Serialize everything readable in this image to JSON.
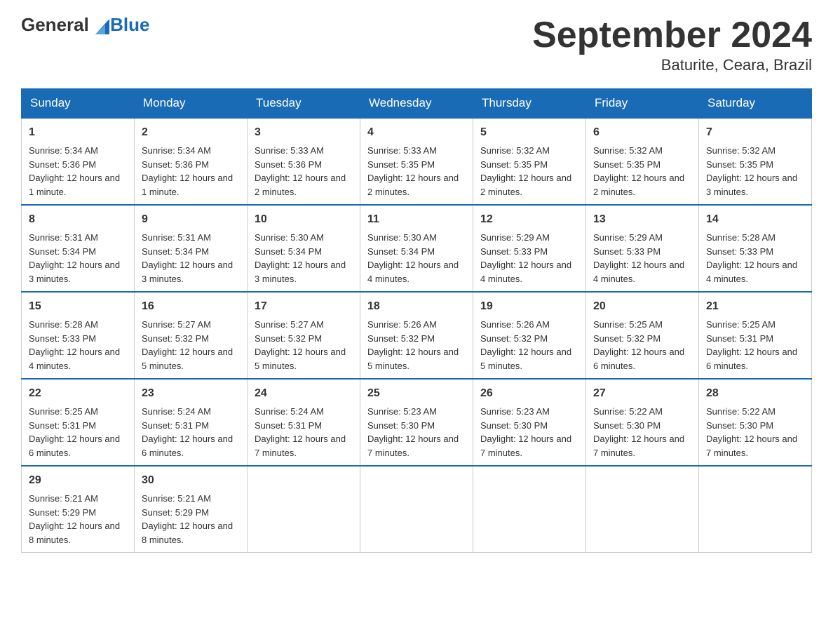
{
  "header": {
    "logo": {
      "general": "General",
      "blue": "Blue"
    },
    "title": "September 2024",
    "subtitle": "Baturite, Ceara, Brazil"
  },
  "weekdays": [
    "Sunday",
    "Monday",
    "Tuesday",
    "Wednesday",
    "Thursday",
    "Friday",
    "Saturday"
  ],
  "weeks": [
    [
      {
        "day": "1",
        "sunrise": "5:34 AM",
        "sunset": "5:36 PM",
        "daylight": "12 hours and 1 minute."
      },
      {
        "day": "2",
        "sunrise": "5:34 AM",
        "sunset": "5:36 PM",
        "daylight": "12 hours and 1 minute."
      },
      {
        "day": "3",
        "sunrise": "5:33 AM",
        "sunset": "5:36 PM",
        "daylight": "12 hours and 2 minutes."
      },
      {
        "day": "4",
        "sunrise": "5:33 AM",
        "sunset": "5:35 PM",
        "daylight": "12 hours and 2 minutes."
      },
      {
        "day": "5",
        "sunrise": "5:32 AM",
        "sunset": "5:35 PM",
        "daylight": "12 hours and 2 minutes."
      },
      {
        "day": "6",
        "sunrise": "5:32 AM",
        "sunset": "5:35 PM",
        "daylight": "12 hours and 2 minutes."
      },
      {
        "day": "7",
        "sunrise": "5:32 AM",
        "sunset": "5:35 PM",
        "daylight": "12 hours and 3 minutes."
      }
    ],
    [
      {
        "day": "8",
        "sunrise": "5:31 AM",
        "sunset": "5:34 PM",
        "daylight": "12 hours and 3 minutes."
      },
      {
        "day": "9",
        "sunrise": "5:31 AM",
        "sunset": "5:34 PM",
        "daylight": "12 hours and 3 minutes."
      },
      {
        "day": "10",
        "sunrise": "5:30 AM",
        "sunset": "5:34 PM",
        "daylight": "12 hours and 3 minutes."
      },
      {
        "day": "11",
        "sunrise": "5:30 AM",
        "sunset": "5:34 PM",
        "daylight": "12 hours and 4 minutes."
      },
      {
        "day": "12",
        "sunrise": "5:29 AM",
        "sunset": "5:33 PM",
        "daylight": "12 hours and 4 minutes."
      },
      {
        "day": "13",
        "sunrise": "5:29 AM",
        "sunset": "5:33 PM",
        "daylight": "12 hours and 4 minutes."
      },
      {
        "day": "14",
        "sunrise": "5:28 AM",
        "sunset": "5:33 PM",
        "daylight": "12 hours and 4 minutes."
      }
    ],
    [
      {
        "day": "15",
        "sunrise": "5:28 AM",
        "sunset": "5:33 PM",
        "daylight": "12 hours and 4 minutes."
      },
      {
        "day": "16",
        "sunrise": "5:27 AM",
        "sunset": "5:32 PM",
        "daylight": "12 hours and 5 minutes."
      },
      {
        "day": "17",
        "sunrise": "5:27 AM",
        "sunset": "5:32 PM",
        "daylight": "12 hours and 5 minutes."
      },
      {
        "day": "18",
        "sunrise": "5:26 AM",
        "sunset": "5:32 PM",
        "daylight": "12 hours and 5 minutes."
      },
      {
        "day": "19",
        "sunrise": "5:26 AM",
        "sunset": "5:32 PM",
        "daylight": "12 hours and 5 minutes."
      },
      {
        "day": "20",
        "sunrise": "5:25 AM",
        "sunset": "5:32 PM",
        "daylight": "12 hours and 6 minutes."
      },
      {
        "day": "21",
        "sunrise": "5:25 AM",
        "sunset": "5:31 PM",
        "daylight": "12 hours and 6 minutes."
      }
    ],
    [
      {
        "day": "22",
        "sunrise": "5:25 AM",
        "sunset": "5:31 PM",
        "daylight": "12 hours and 6 minutes."
      },
      {
        "day": "23",
        "sunrise": "5:24 AM",
        "sunset": "5:31 PM",
        "daylight": "12 hours and 6 minutes."
      },
      {
        "day": "24",
        "sunrise": "5:24 AM",
        "sunset": "5:31 PM",
        "daylight": "12 hours and 7 minutes."
      },
      {
        "day": "25",
        "sunrise": "5:23 AM",
        "sunset": "5:30 PM",
        "daylight": "12 hours and 7 minutes."
      },
      {
        "day": "26",
        "sunrise": "5:23 AM",
        "sunset": "5:30 PM",
        "daylight": "12 hours and 7 minutes."
      },
      {
        "day": "27",
        "sunrise": "5:22 AM",
        "sunset": "5:30 PM",
        "daylight": "12 hours and 7 minutes."
      },
      {
        "day": "28",
        "sunrise": "5:22 AM",
        "sunset": "5:30 PM",
        "daylight": "12 hours and 7 minutes."
      }
    ],
    [
      {
        "day": "29",
        "sunrise": "5:21 AM",
        "sunset": "5:29 PM",
        "daylight": "12 hours and 8 minutes."
      },
      {
        "day": "30",
        "sunrise": "5:21 AM",
        "sunset": "5:29 PM",
        "daylight": "12 hours and 8 minutes."
      },
      null,
      null,
      null,
      null,
      null
    ]
  ],
  "labels": {
    "sunrise": "Sunrise:",
    "sunset": "Sunset:",
    "daylight": "Daylight:"
  }
}
